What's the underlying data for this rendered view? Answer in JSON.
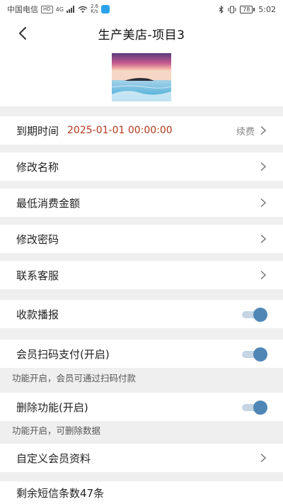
{
  "status_bar": {
    "carrier": "中国电信",
    "hd_badge": "HD",
    "signal": "4G",
    "net_speed_value": "2.6",
    "net_speed_unit": "K/s",
    "battery": "78",
    "time": "5:02"
  },
  "navbar": {
    "title": "生产美店-项目3",
    "back_icon": "chevron-left-icon"
  },
  "rows": {
    "expiry": {
      "label": "到期时间",
      "value": "2025-01-01 00:00:00",
      "action": "续费"
    },
    "rename": {
      "label": "修改名称"
    },
    "min_spend": {
      "label": "最低消费金额"
    },
    "password": {
      "label": "修改密码"
    },
    "support": {
      "label": "联系客服"
    },
    "payment_broadcast": {
      "label": "收款播报",
      "enabled": true
    },
    "member_scan_pay": {
      "label": "会员扫码支付(开启)",
      "enabled": true,
      "hint": "功能开启，会员可通过扫码付款"
    },
    "delete_function": {
      "label": "删除功能(开启)",
      "enabled": true,
      "hint": "功能开启，可删除数据"
    },
    "custom_member": {
      "label": "自定义会员资料"
    },
    "sms_remaining": {
      "label": "剩余短信条数47条"
    }
  },
  "colors": {
    "accent_toggle": "#4f86b6",
    "expiry_value": "#b33a1f",
    "background": "#efefef"
  }
}
